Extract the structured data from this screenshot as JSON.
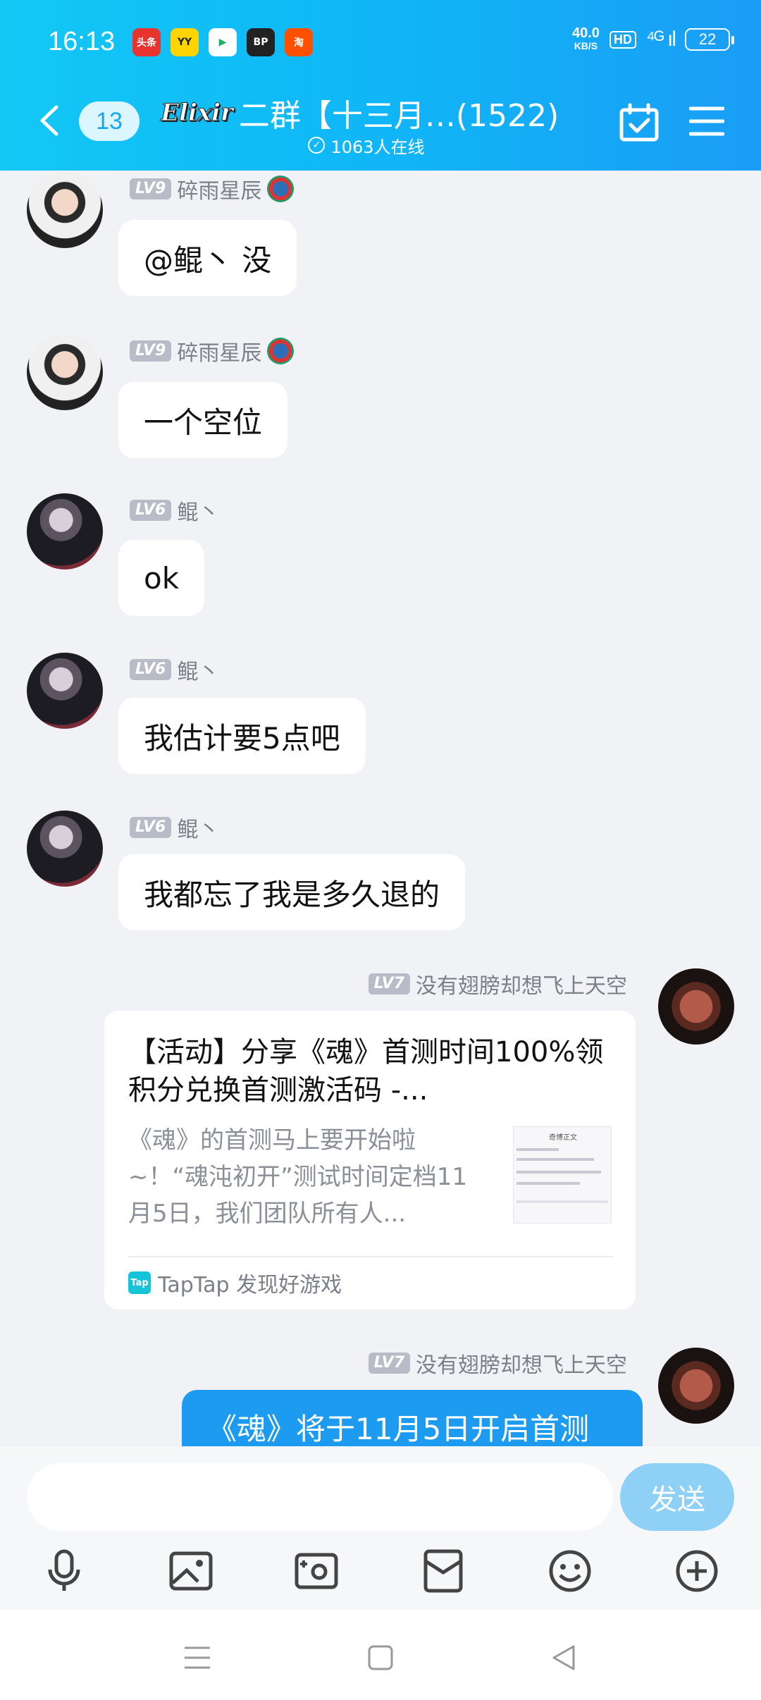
{
  "status_bar": {
    "time": "16:13",
    "app_icons": [
      "头条",
      "YY",
      "▶",
      "BP",
      "淘"
    ],
    "net_speed_value": "40.0",
    "net_speed_unit": "KB/S",
    "hd": "HD",
    "signal": "⁴ᴳ ıl",
    "battery": "22"
  },
  "header": {
    "unread_count": "13",
    "logo_text": "Elixir",
    "title": "二群【十三月…(1522)",
    "online": "1063人在线"
  },
  "messages": [
    {
      "level": "LV9",
      "name": "碎雨星辰",
      "text": "@鲲丶 没"
    },
    {
      "level": "LV9",
      "name": "碎雨星辰",
      "text": "一个空位"
    },
    {
      "level": "LV6",
      "name": "鲲丶",
      "text": "ok"
    },
    {
      "level": "LV6",
      "name": "鲲丶",
      "text": "我估计要5点吧"
    },
    {
      "level": "LV6",
      "name": "鲲丶",
      "text": "我都忘了我是多久退的"
    }
  ],
  "share": {
    "level": "LV7",
    "name": "没有翅膀却想飞上天空",
    "title": "【活动】分享《魂》首测时间100%领积分兑换首测激活码 -...",
    "desc": "《魂》的首测马上要开始啦~！“魂沌初开”测试时间定档11月5日，我们团队所有人...",
    "thumb_heading": "奇博正文",
    "source_logo": "Tap",
    "source": "TapTap 发现好游戏"
  },
  "last_message": {
    "level": "LV7",
    "name": "没有翅膀却想飞上天空",
    "text": "《魂》将于11月5日开启首测"
  },
  "input": {
    "placeholder": "",
    "send_label": "发送"
  },
  "toolbar_icons": [
    "microphone-icon",
    "image-icon",
    "camera-icon",
    "red-packet-icon",
    "emoji-icon",
    "plus-icon"
  ],
  "colors": {
    "header_start": "#12c8f5",
    "header_end": "#1a9df5",
    "bubble_self": "#1d9bf0",
    "send_button": "#8fd0f7",
    "background": "#f1f2f5"
  }
}
